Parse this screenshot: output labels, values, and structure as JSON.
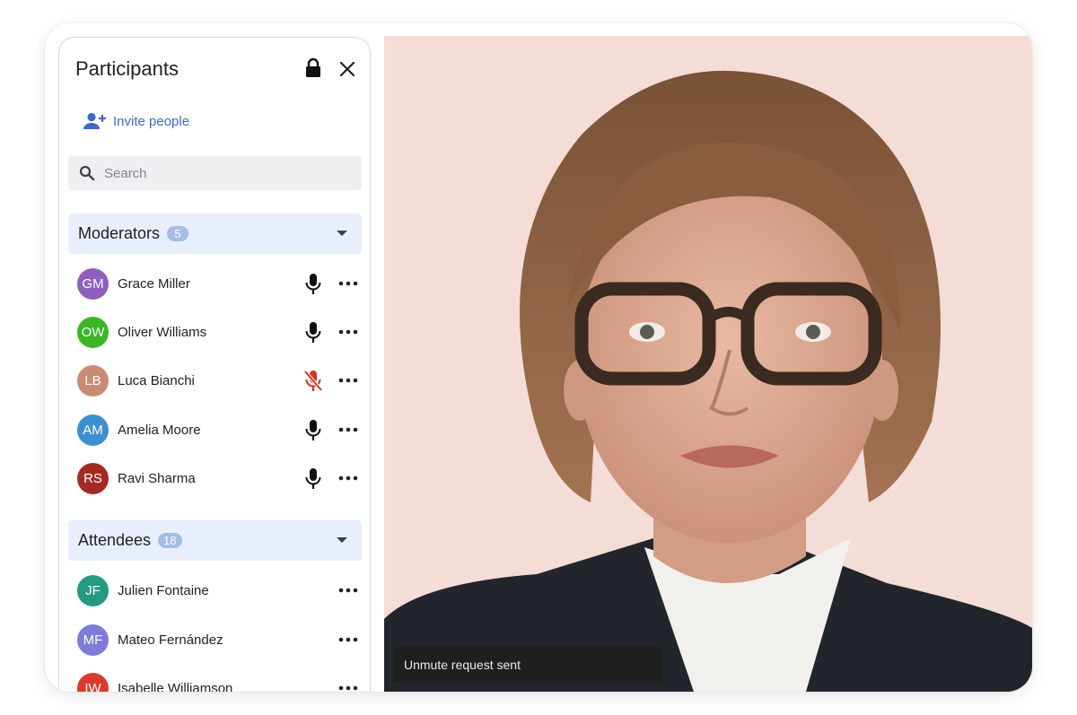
{
  "panel": {
    "title": "Participants",
    "invite_label": "Invite people",
    "search_placeholder": "Search"
  },
  "moderators": {
    "label": "Moderators",
    "count": "5",
    "members": [
      {
        "initials": "GM",
        "name": "Grace Miller",
        "color": "#8e5fbd",
        "mic": "on"
      },
      {
        "initials": "OW",
        "name": "Oliver Williams",
        "color": "#3cb527",
        "mic": "on"
      },
      {
        "initials": "LB",
        "name": "Luca Bianchi",
        "color": "#c98a76",
        "mic": "muted"
      },
      {
        "initials": "AM",
        "name": "Amelia Moore",
        "color": "#3d8fd1",
        "mic": "on"
      },
      {
        "initials": "RS",
        "name": "Ravi Sharma",
        "color": "#a32a24",
        "mic": "on"
      }
    ]
  },
  "attendees": {
    "label": "Attendees",
    "count": "18",
    "members": [
      {
        "initials": "JF",
        "name": "Julien Fontaine",
        "color": "#249a80"
      },
      {
        "initials": "MF",
        "name": "Mateo Fernández",
        "color": "#7e7bd9"
      },
      {
        "initials": "IW",
        "name": "Isabelle Williamson",
        "color": "#d93a2b"
      }
    ]
  },
  "toast": {
    "message": "Unmute request sent"
  },
  "colors": {
    "accent": "#3b6bc6",
    "section_bg": "#e8eefc",
    "muted_mic": "#d93025",
    "video_bg": "#f3ddd6"
  }
}
